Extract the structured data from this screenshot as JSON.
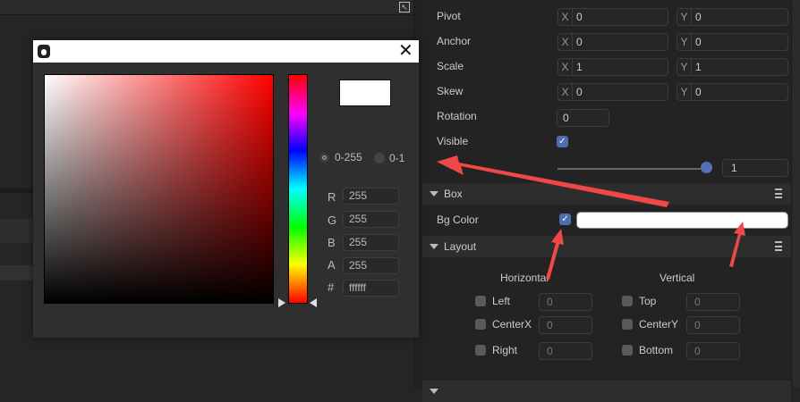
{
  "inspector": {
    "rows": [
      {
        "label": "Pivot",
        "x": "0",
        "y": "0"
      },
      {
        "label": "Anchor",
        "x": "0",
        "y": "0"
      },
      {
        "label": "Scale",
        "x": "1",
        "y": "1"
      },
      {
        "label": "Skew",
        "x": "0",
        "y": "0"
      }
    ],
    "axis_x": "X",
    "axis_y": "Y",
    "rotation": {
      "label": "Rotation",
      "value": "0"
    },
    "visible": {
      "label": "Visible",
      "checked": true
    },
    "opacity": {
      "value": "1",
      "fraction": 1.0
    },
    "box": {
      "title": "Box",
      "bg_color_label": "Bg Color",
      "bg_color": "#ffffff",
      "enabled": true
    },
    "layout": {
      "title": "Layout",
      "horizontal": "Horizontal",
      "vertical": "Vertical",
      "h": [
        {
          "label": "Left",
          "value": "0"
        },
        {
          "label": "CenterX",
          "value": "0"
        },
        {
          "label": "Right",
          "value": "0"
        }
      ],
      "v": [
        {
          "label": "Top",
          "value": "0"
        },
        {
          "label": "CenterY",
          "value": "0"
        },
        {
          "label": "Bottom",
          "value": "0"
        }
      ]
    }
  },
  "color_picker": {
    "mode_255": "0-255",
    "mode_1": "0-1",
    "r_label": "R",
    "g_label": "G",
    "b_label": "B",
    "a_label": "A",
    "hex_label": "#",
    "r": "255",
    "g": "255",
    "b": "255",
    "a": "255",
    "hex": "ffffff",
    "preview_color": "#ffffff",
    "hue_color": "#ff0000"
  },
  "annotation_color": "#f04848"
}
